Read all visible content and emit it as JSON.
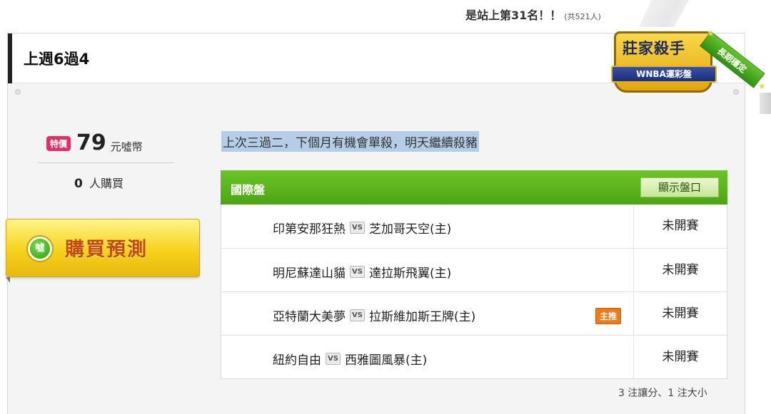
{
  "rank": {
    "text": "是站上第31名！！",
    "total": "(共521人)"
  },
  "header": {
    "title": "上週6過4"
  },
  "badge": {
    "main": "莊家殺手",
    "ribbon": "WNBA運彩盤",
    "sash": "長期穩定"
  },
  "pricing": {
    "tag": "特價",
    "amount": "79",
    "unit": "元噓幣",
    "buyers_count": "0",
    "buyers_label": "人購買"
  },
  "buy_button": {
    "coin_label": "噓",
    "label": "購買預測"
  },
  "comment": "上次三過二，下個月有機會單殺，明天繼續殺豬",
  "games": {
    "title": "國際盤",
    "show_button": "顯示盤口",
    "vs_label": "VS",
    "rows": [
      {
        "away": "印第安那狂熱",
        "home": "芝加哥天空(主)",
        "status": "未開賽",
        "pick": ""
      },
      {
        "away": "明尼蘇達山貓",
        "home": "達拉斯飛翼(主)",
        "status": "未開賽",
        "pick": ""
      },
      {
        "away": "亞特蘭大美夢",
        "home": "拉斯維加斯王牌(主)",
        "status": "未開賽",
        "pick": "主推"
      },
      {
        "away": "紐約自由",
        "home": "西雅圖風暴(主)",
        "status": "未開賽",
        "pick": ""
      }
    ]
  },
  "summary": "3 注讓分、1 注大小",
  "colors": {
    "accent_green": "#4da414",
    "buy_yellow": "#f5d21a",
    "special_pink": "#e0306a",
    "pick_orange": "#f07a1a",
    "highlight": "#b5cde6"
  }
}
